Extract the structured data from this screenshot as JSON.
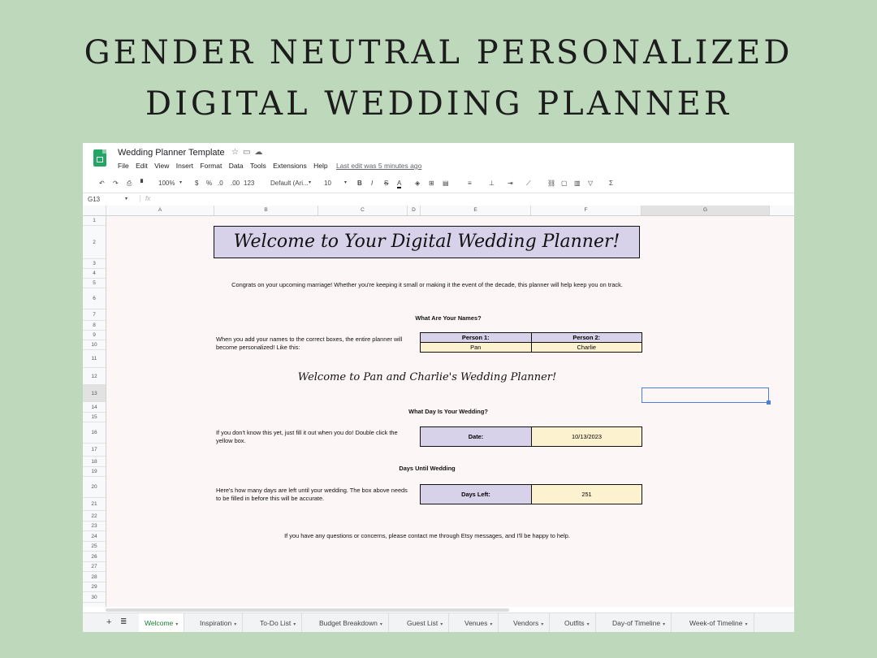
{
  "hero": {
    "line1": "GENDER NEUTRAL PERSONALIZED",
    "line2": "DIGITAL WEDDING PLANNER"
  },
  "app": {
    "title": "Wedding Planner Template",
    "menus": [
      "File",
      "Edit",
      "View",
      "Insert",
      "Format",
      "Data",
      "Tools",
      "Extensions",
      "Help"
    ],
    "last_edit": "Last edit was 5 minutes ago",
    "toolbar": {
      "zoom": "100%",
      "currency": "$",
      "percent": "%",
      "dec_less": ".0",
      "dec_more": ".00",
      "format_more": "123",
      "font": "Default (Ari...",
      "size": "10"
    },
    "namebox": "G13",
    "fx": "fx",
    "columns": [
      "A",
      "B",
      "C",
      "D",
      "E",
      "F",
      "G"
    ],
    "rows": [
      "1",
      "2",
      "3",
      "4",
      "5",
      "6",
      "7",
      "8",
      "9",
      "10",
      "11",
      "12",
      "13",
      "14",
      "15",
      "16",
      "17",
      "18",
      "19",
      "20",
      "21",
      "22",
      "23",
      "24",
      "25",
      "26",
      "27",
      "28",
      "29",
      "30"
    ]
  },
  "sheet": {
    "banner": "Welcome to Your Digital Wedding Planner!",
    "intro": "Congrats on your upcoming marriage! Whether you're keeping it small or making it the event of the decade, this planner will help keep you on track.",
    "names_heading": "What Are Your Names?",
    "names_help": "When you add your names to the correct boxes, the entire planner will become personalized! Like this:",
    "person1_label": "Person 1:",
    "person2_label": "Person 2:",
    "person1": "Pan",
    "person2": "Charlie",
    "welcome2": "Welcome to Pan and Charlie's Wedding Planner!",
    "day_heading": "What Day Is Your Wedding?",
    "day_help": "If you don't know this yet, just fill it out when you do! Double click the yellow box.",
    "date_label": "Date:",
    "date_value": "10/13/2023",
    "days_heading": "Days Until Wedding",
    "days_help": "Here's how many days are left until your wedding. The box above needs to be filled in before this will be accurate.",
    "days_label": "Days Left:",
    "days_value": "251",
    "contact": "If you have any questions or concerns, please contact me through Etsy messages, and I'll be happy to help."
  },
  "tabs": [
    "Welcome",
    "Inspiration",
    "To-Do List",
    "Budget Breakdown",
    "Guest List",
    "Venues",
    "Vendors",
    "Outfits",
    "Day-of Timeline",
    "Week-of Timeline"
  ]
}
